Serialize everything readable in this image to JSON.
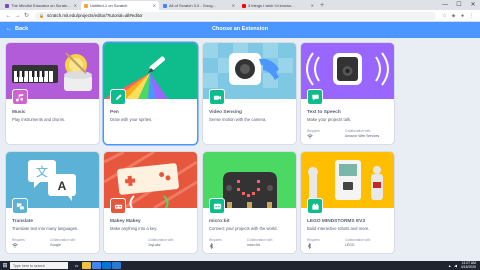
{
  "browser": {
    "tabs": [
      {
        "title": "The Mindful Educator on ScratchX",
        "favicon_color": "#7b4bc4",
        "active": false
      },
      {
        "title": "Untitled-1 on Scratch",
        "favicon_color": "#f6a43a",
        "active": true
      },
      {
        "title": "All of Scratch 3.0 - Goog...",
        "favicon_color": "#4285f4",
        "active": false
      },
      {
        "title": "3 things I wish I'd known...",
        "favicon_color": "#ff0000",
        "active": false
      }
    ],
    "new_tab": "+",
    "url": "scratch.mit.edu/projects/editor/?tutorial=all#editor",
    "window_controls": {
      "minimize": "—",
      "maximize": "☐",
      "close": "✕"
    }
  },
  "scratch": {
    "back_label": "Back",
    "title": "Choose an Extension",
    "accent": "#4c97ff"
  },
  "extensions": [
    {
      "name": "Music",
      "description": "Play instruments and drums.",
      "color": "#cf63cf",
      "icon": "music-note-icon",
      "bg": "#b25cd9"
    },
    {
      "name": "Pen",
      "description": "Draw with your sprites.",
      "color": "#0fbd8c",
      "icon": "pen-icon",
      "bg": "#0fbd8c"
    },
    {
      "name": "Video Sensing",
      "description": "Sense motion with the camera.",
      "color": "#0fbd8c",
      "icon": "video-icon",
      "bg": "#7ec8e3"
    },
    {
      "name": "Text to Speech",
      "description": "Make your projects talk.",
      "color": "#9966ff",
      "icon": "speech-bubble-icon",
      "bg": "#9966ff",
      "requirements_label": "Requires",
      "collab_label": "Collaboration with",
      "collab": "Amazon Web Services"
    },
    {
      "name": "Translate",
      "description": "Translate text into many languages.",
      "color": "#5cb1d6",
      "icon": "translate-icon",
      "bg": "#5cb1d6",
      "requirements_label": "Requires",
      "collab_label": "Collaboration with",
      "collab": "Google"
    },
    {
      "name": "Makey Makey",
      "description": "Make anything into a key.",
      "color": "#e6573d",
      "icon": "makey-icon",
      "bg": "#e6573d",
      "collab_label": "Collaboration with",
      "collab": "JoyLabz"
    },
    {
      "name": "micro:bit",
      "description": "Connect your projects with the world.",
      "color": "#0fbd8c",
      "icon": "microbit-icon",
      "bg": "#4cd963",
      "requirements_label": "Requires",
      "collab_label": "Collaboration with",
      "collab": "micro:bit"
    },
    {
      "name": "LEGO MINDSTORMS EV3",
      "description": "Build interactive robots and more.",
      "color": "#0fbd8c",
      "icon": "lego-icon",
      "bg": "#ffbf00",
      "requirements_label": "Requires",
      "collab_label": "Collaboration with",
      "collab": "LEGO"
    }
  ],
  "taskbar": {
    "search_placeholder": "Type here to search",
    "time": "11:07 AM",
    "date": "4/15/2020"
  }
}
